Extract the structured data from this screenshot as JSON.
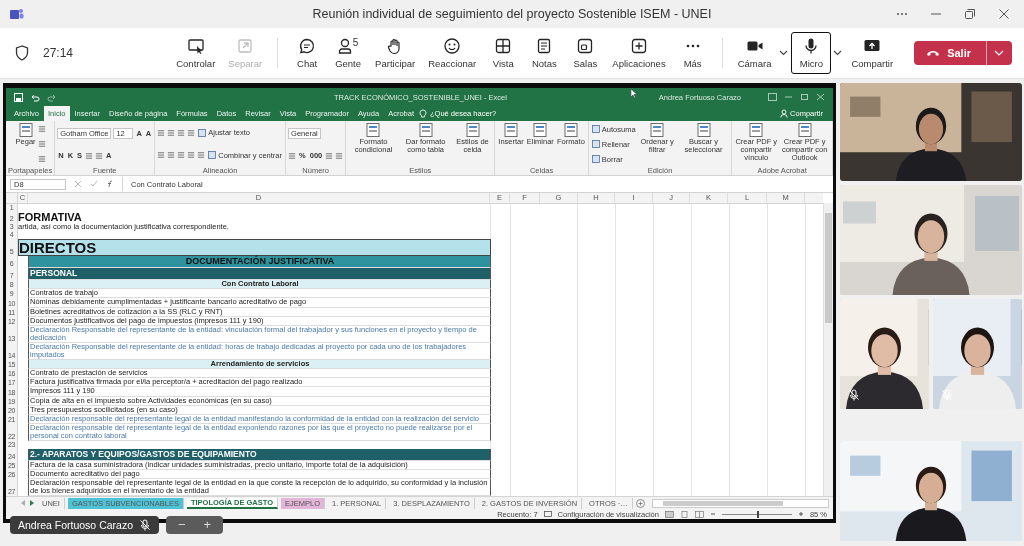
{
  "window": {
    "title": "Reunión individual de seguimiento del proyecto Sostenible ISEM - UNEI"
  },
  "meeting": {
    "timer": "27:14",
    "groups": [
      {
        "buttons": [
          {
            "kind": "control",
            "label": "Controlar",
            "disabled": false,
            "selected": false
          },
          {
            "kind": "popout",
            "label": "Separar",
            "disabled": true,
            "selected": false
          }
        ]
      },
      {
        "buttons": [
          {
            "kind": "chat",
            "label": "Chat",
            "disabled": false,
            "selected": false
          },
          {
            "kind": "people",
            "label": "Gente",
            "count": "5",
            "disabled": false,
            "selected": false
          },
          {
            "kind": "raise",
            "label": "Participar",
            "disabled": false,
            "selected": false
          },
          {
            "kind": "react",
            "label": "Reaccionar",
            "disabled": false,
            "selected": false
          },
          {
            "kind": "view",
            "label": "Vista",
            "disabled": false,
            "selected": false
          },
          {
            "kind": "notes",
            "label": "Notas",
            "disabled": false,
            "selected": false
          },
          {
            "kind": "rooms",
            "label": "Salas",
            "disabled": false,
            "selected": false
          },
          {
            "kind": "apps",
            "label": "Aplicaciones",
            "disabled": false,
            "selected": false
          },
          {
            "kind": "more",
            "label": "Más",
            "disabled": false,
            "selected": false
          }
        ]
      },
      {
        "buttons": [
          {
            "kind": "camera",
            "label": "Cámara",
            "menu": true,
            "disabled": false,
            "selected": false
          },
          {
            "kind": "mic",
            "label": "Micro",
            "menu": true,
            "disabled": false,
            "selected": true
          },
          {
            "kind": "share",
            "label": "Compartir",
            "disabled": false,
            "selected": false
          }
        ]
      }
    ],
    "leave": "Salir"
  },
  "excel": {
    "title": "TRACK ECONÓMICO_SOSTENIBLE_UNEI  -  Excel",
    "user": "Andrea Fortuoso Carazo",
    "tabs": [
      {
        "label": "Archivo",
        "selected": false
      },
      {
        "label": "Inicio",
        "selected": true
      },
      {
        "label": "Insertar",
        "selected": false
      },
      {
        "label": "Diseño de página",
        "selected": false
      },
      {
        "label": "Fórmulas",
        "selected": false
      },
      {
        "label": "Datos",
        "selected": false
      },
      {
        "label": "Revisar",
        "selected": false
      },
      {
        "label": "Vista",
        "selected": false
      },
      {
        "label": "Programador",
        "selected": false
      },
      {
        "label": "Ayuda",
        "selected": false
      },
      {
        "label": "Acrobat",
        "selected": false
      }
    ],
    "tell_me": "¿Qué desea hacer?",
    "share": "Compartir",
    "ribbon": [
      {
        "name": "Portapapeles",
        "columns": [
          {
            "kind": "large",
            "label": "Pegar"
          },
          {
            "kind": "stack",
            "rows": [
              {
                "items": [
                  {
                    "kind": "tool"
                  }
                ]
              },
              {
                "items": [
                  {
                    "kind": "tool"
                  }
                ]
              },
              {
                "items": [
                  {
                    "kind": "tool"
                  }
                ]
              }
            ]
          }
        ]
      },
      {
        "name": "Fuente",
        "columns": [
          {
            "kind": "stack",
            "rows": [
              {
                "items": [
                  {
                    "kind": "field",
                    "value": "Gotham Office"
                  },
                  {
                    "kind": "field",
                    "value": "12"
                  },
                  {
                    "kind": "glyph",
                    "text": "A"
                  },
                  {
                    "kind": "glyph",
                    "text": "A"
                  }
                ]
              },
              {
                "items": [
                  {
                    "kind": "glyph",
                    "text": "N"
                  },
                  {
                    "kind": "glyph",
                    "text": "K"
                  },
                  {
                    "kind": "glyph",
                    "text": "S"
                  },
                  {
                    "kind": "tool"
                  },
                  {
                    "kind": "tool"
                  },
                  {
                    "kind": "glyph",
                    "text": "A"
                  }
                ]
              }
            ]
          }
        ]
      },
      {
        "name": "Alineación",
        "columns": [
          {
            "kind": "stack",
            "rows": [
              {
                "items": [
                  {
                    "kind": "tool"
                  },
                  {
                    "kind": "tool"
                  },
                  {
                    "kind": "tool"
                  },
                  {
                    "kind": "tool"
                  },
                  {
                    "kind": "small",
                    "label": "Ajustar texto"
                  }
                ]
              },
              {
                "items": [
                  {
                    "kind": "tool"
                  },
                  {
                    "kind": "tool"
                  },
                  {
                    "kind": "tool"
                  },
                  {
                    "kind": "tool"
                  },
                  {
                    "kind": "tool"
                  },
                  {
                    "kind": "small",
                    "label": "Combinar y centrar"
                  }
                ]
              }
            ]
          }
        ]
      },
      {
        "name": "Número",
        "columns": [
          {
            "kind": "stack",
            "rows": [
              {
                "items": [
                  {
                    "kind": "field",
                    "value": "General"
                  }
                ]
              },
              {
                "items": [
                  {
                    "kind": "tool"
                  },
                  {
                    "kind": "glyph",
                    "text": "%"
                  },
                  {
                    "kind": "glyph",
                    "text": "000"
                  },
                  {
                    "kind": "tool"
                  },
                  {
                    "kind": "tool"
                  }
                ]
              }
            ]
          }
        ]
      },
      {
        "name": "Estilos",
        "columns": [
          {
            "kind": "large",
            "label": "Formato condicional"
          },
          {
            "kind": "large",
            "label": "Dar formato como tabla"
          },
          {
            "kind": "large",
            "label": "Estilos de celda"
          }
        ]
      },
      {
        "name": "Celdas",
        "columns": [
          {
            "kind": "large",
            "label": "Insertar"
          },
          {
            "kind": "large",
            "label": "Eliminar"
          },
          {
            "kind": "large",
            "label": "Formato"
          }
        ]
      },
      {
        "name": "Edición",
        "columns": [
          {
            "kind": "stack",
            "rows": [
              {
                "items": [
                  {
                    "kind": "small",
                    "label": "Autosuma"
                  }
                ]
              },
              {
                "items": [
                  {
                    "kind": "small",
                    "label": "Rellenar"
                  }
                ]
              },
              {
                "items": [
                  {
                    "kind": "small",
                    "label": "Borrar"
                  }
                ]
              }
            ]
          },
          {
            "kind": "large",
            "label": "Ordenar y filtrar"
          },
          {
            "kind": "large",
            "label": "Buscar y seleccionar"
          }
        ]
      },
      {
        "name": "Adobe Acrobat",
        "columns": [
          {
            "kind": "large",
            "label": "Crear PDF y compartir vínculo"
          },
          {
            "kind": "large",
            "label": "Crear PDF y compartir con Outlook"
          }
        ]
      }
    ],
    "name_box": "D8",
    "formula": "Con Contrato Laboral",
    "columns": [
      "C",
      "D",
      "E",
      "F",
      "G",
      "H",
      "I",
      "J",
      "K",
      "L",
      "M"
    ],
    "rows": [
      {
        "n": "1",
        "kind": "blank"
      },
      {
        "n": "2",
        "kind": "heading",
        "text": "FORMATIVA"
      },
      {
        "n": "3",
        "kind": "text",
        "text": "artida, así como la documentación justificativa correspondiente."
      },
      {
        "n": "4",
        "kind": "blank"
      },
      {
        "n": "5",
        "kind": "banner",
        "text": "DIRECTOS"
      },
      {
        "n": "6",
        "kind": "title",
        "text": "DOCUMENTACIÓN JUSTIFICATIVA"
      },
      {
        "n": "7",
        "kind": "section",
        "text": "PERSONAL"
      },
      {
        "n": "8",
        "kind": "subheader",
        "text": "Con Contrato Laboral"
      },
      {
        "n": "9",
        "kind": "item",
        "text": "Contratos de trabajo"
      },
      {
        "n": "10",
        "kind": "item",
        "text": "Nóminas debidamente cumplimentadas + justificante bancario acreditativo de pago"
      },
      {
        "n": "11",
        "kind": "item",
        "text": "Boletines acreditativos de cotización a la SS (RLC y RNT)"
      },
      {
        "n": "12",
        "kind": "item",
        "text": "Documentos justificativos del pago de impuestos (impresos 111 y 190)"
      },
      {
        "n": "13",
        "kind": "note",
        "wrap": true,
        "text": "Declaración Responsable del representante de la entidad: vinculación formal del trabajador y sus funciones en el proyecto y tiempo de dedicación"
      },
      {
        "n": "14",
        "kind": "note",
        "wrap": true,
        "text": "Declaración Responsable del representante de la entidad: horas de trabajo dedicadas al proyecto por cada uno de los trabajadores imputados"
      },
      {
        "n": "15",
        "kind": "subheader",
        "text": "Arrendamiento de servicios"
      },
      {
        "n": "16",
        "kind": "item",
        "text": "Contrato de prestación de servicios"
      },
      {
        "n": "17",
        "kind": "item",
        "text": "Factura justificativa firmada por el/la perceptor/a + acreditación del pago realizado"
      },
      {
        "n": "18",
        "kind": "item",
        "text": "Impresos 111 y 190"
      },
      {
        "n": "19",
        "kind": "item",
        "text": "Copia de alta en el Impuesto sobre Actividades económicas (en su caso)"
      },
      {
        "n": "20",
        "kind": "item",
        "text": "Tres presupuestos socilicitados (en su caso)"
      },
      {
        "n": "21",
        "kind": "note",
        "text": "Declaración responsable del representante legal de la entidad manifestando la conformidad de la entidad con la realización del servicio"
      },
      {
        "n": "22",
        "kind": "note",
        "wrap": true,
        "text": "Declaración responsable del representante legal de la entidad exponiendo razones por las que el proyecto no puede realizarse por el personal con contrato laboral"
      },
      {
        "n": "23",
        "kind": "blank"
      },
      {
        "n": "24",
        "kind": "section",
        "text": "2.- APARATOS Y EQUIPOS/GASTOS DE EQUIPAMIENTO"
      },
      {
        "n": "25",
        "kind": "item",
        "text": "Factura de la casa suministradora (indicar unidades suministradas, precio unitario, importe total de la adquisición)"
      },
      {
        "n": "26",
        "kind": "item",
        "text": "Documento acreditativo del pago"
      },
      {
        "n": "27",
        "kind": "item",
        "wrap": true,
        "text": "Declaración responsable del representante legal de la entidad en la que conste la recepción de lo adquirido, su conformidad y la inclusión de los bienes adquiridos en el inventario de la entidad"
      }
    ],
    "sheet_tabs": [
      {
        "label": "UNEI",
        "selected": false
      },
      {
        "label": "GASTOS SUBVENCIONABLES",
        "color": "#4fc3d6",
        "selected": false
      },
      {
        "label": "TIPOLOGÍA DE GASTO",
        "selected": true
      },
      {
        "label": "EJEMPLO",
        "color": "#e3b5d9",
        "selected": false
      },
      {
        "label": "1. PERSONAL",
        "selected": false
      },
      {
        "label": "3. DESPLAZAMIENTO",
        "selected": false
      },
      {
        "label": "2. GASTOS DE INVERSIÓN",
        "selected": false
      },
      {
        "label": "OTROS ·…",
        "selected": false
      }
    ],
    "status": {
      "count": "Recuento: 7",
      "display": "Configuración de visualización",
      "zoom": "85 %",
      "zoom_slider": {
        "level": 0.5
      }
    }
  },
  "video_rows": [
    {
      "tiles": [
        {
          "muted": false
        }
      ]
    },
    {
      "tiles": [
        {
          "muted": false
        }
      ]
    },
    {
      "tiles": [
        {
          "muted": true
        },
        {
          "muted": true
        }
      ]
    },
    {
      "tiles": [
        {
          "muted": false
        }
      ]
    }
  ],
  "self_view": {
    "name": "Andrea Fortuoso Carazo",
    "muted": true
  },
  "share_zoom": [
    "−",
    "+"
  ]
}
